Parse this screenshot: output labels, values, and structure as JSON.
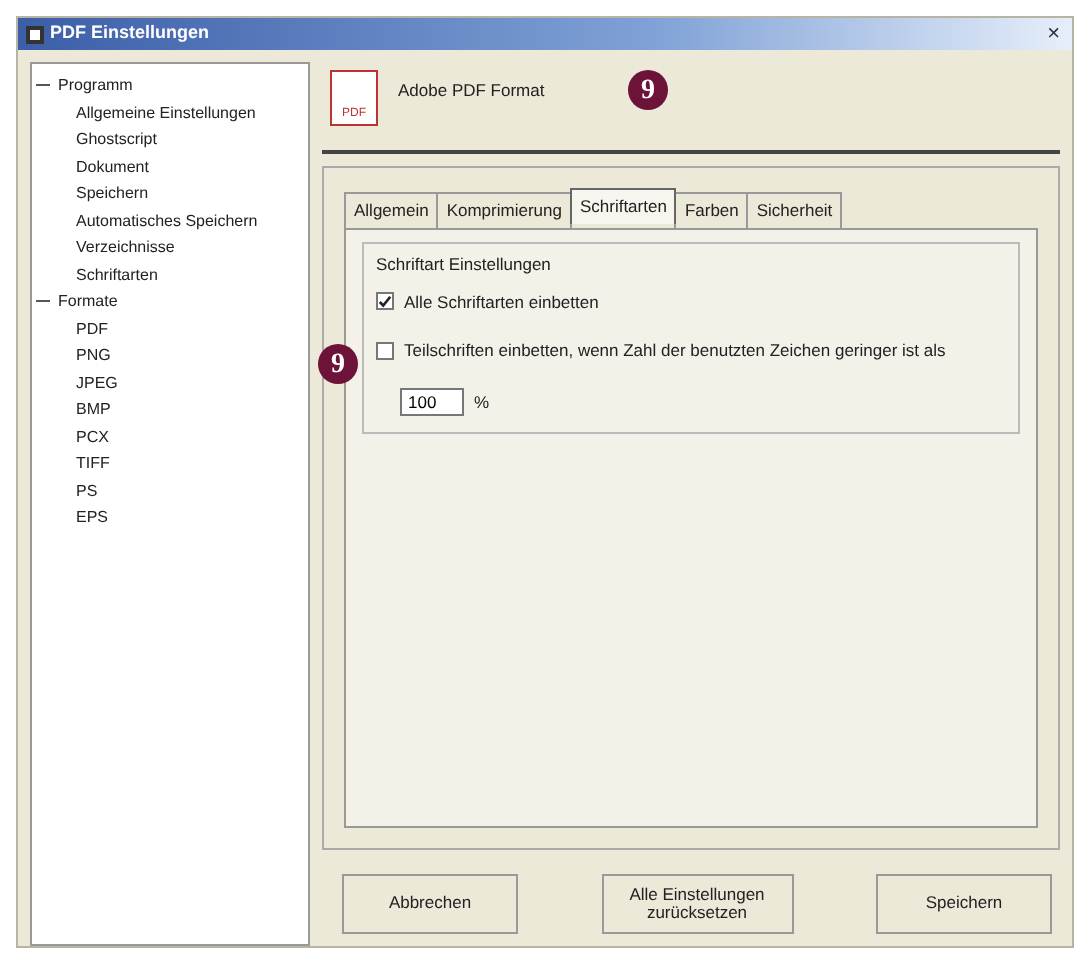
{
  "window": {
    "title": "PDF Einstellungen",
    "close": "×"
  },
  "tree": [
    {
      "label": "Programm",
      "expanded": true,
      "children": [
        {
          "label": "Allgemeine Einstellungen"
        },
        {
          "label": "Ghostscript"
        },
        {
          "label": "Dokument"
        },
        {
          "label": "Speichern"
        },
        {
          "label": "Automatisches Speichern"
        },
        {
          "label": "Verzeichnisse"
        },
        {
          "label": "Schriftarten"
        }
      ]
    },
    {
      "label": "Formate",
      "expanded": true,
      "children": [
        {
          "label": "PDF"
        },
        {
          "label": "PNG"
        },
        {
          "label": "JPEG"
        },
        {
          "label": "BMP"
        },
        {
          "label": "PCX"
        },
        {
          "label": "TIFF"
        },
        {
          "label": "PS"
        },
        {
          "label": "EPS"
        }
      ]
    }
  ],
  "header": {
    "icon_label": "PDF",
    "title": "Adobe PDF Format"
  },
  "tabs": [
    {
      "label": "Allgemein",
      "selected": false
    },
    {
      "label": "Komprimierung",
      "selected": false
    },
    {
      "label": "Schriftarten",
      "selected": true
    },
    {
      "label": "Farben",
      "selected": false
    },
    {
      "label": "Sicherheit",
      "selected": false
    }
  ],
  "group": {
    "title": "Schriftart Einstellungen",
    "options": [
      {
        "label": "Alle Schriftarten einbetten",
        "checked": true
      },
      {
        "label": "Teilschriften einbetten, wenn Zahl der benutzten Zeichen geringer ist als",
        "checked": false
      }
    ],
    "percent": {
      "value": "100",
      "unit": "%"
    }
  },
  "buttons": [
    "Abbrechen",
    "Alle Einstellungen zurücksetzen",
    "Speichern"
  ],
  "callouts": [
    "9",
    "9"
  ]
}
